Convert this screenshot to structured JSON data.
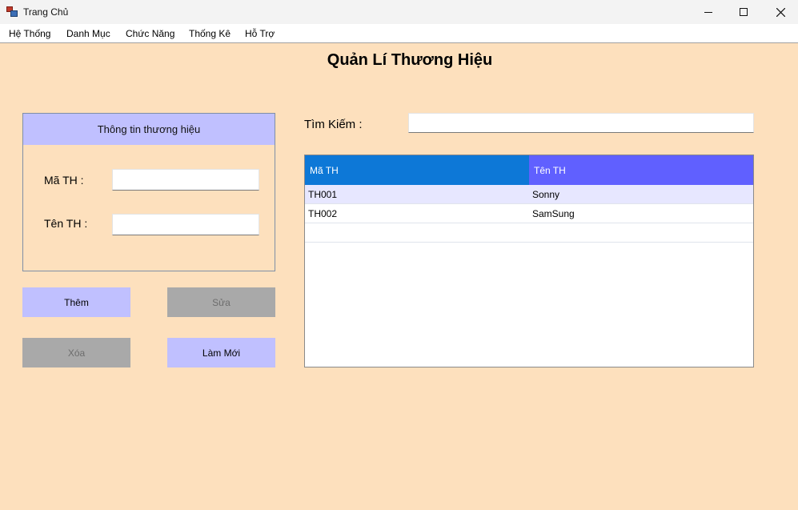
{
  "window": {
    "title": "Trang Chủ"
  },
  "menu": [
    {
      "label": "Hệ Thống"
    },
    {
      "label": "Danh Mục"
    },
    {
      "label": "Chức Năng"
    },
    {
      "label": "Thống Kê"
    },
    {
      "label": "Hỗ Trợ"
    }
  ],
  "page": {
    "title": "Quản Lí Thương Hiệu"
  },
  "info_panel": {
    "header": "Thông tin thương hiệu",
    "ma_label": "Mã TH :",
    "ma_value": "",
    "ten_label": "Tên TH :",
    "ten_value": ""
  },
  "buttons": {
    "them": "Thêm",
    "sua": "Sửa",
    "xoa": "Xóa",
    "lam_moi": "Làm Mới"
  },
  "search": {
    "label": "Tìm Kiếm :",
    "value": ""
  },
  "grid": {
    "columns": [
      "Mã TH",
      "Tên TH"
    ],
    "rows": [
      [
        "TH001",
        "Sonny"
      ],
      [
        "TH002",
        "SamSung"
      ]
    ]
  },
  "colors": {
    "background": "#fde0bd",
    "button_enabled": "#c0c0ff",
    "button_disabled": "#a9a9a9",
    "grid_header_1": "#0d78d7",
    "grid_header_2": "#6060ff"
  }
}
